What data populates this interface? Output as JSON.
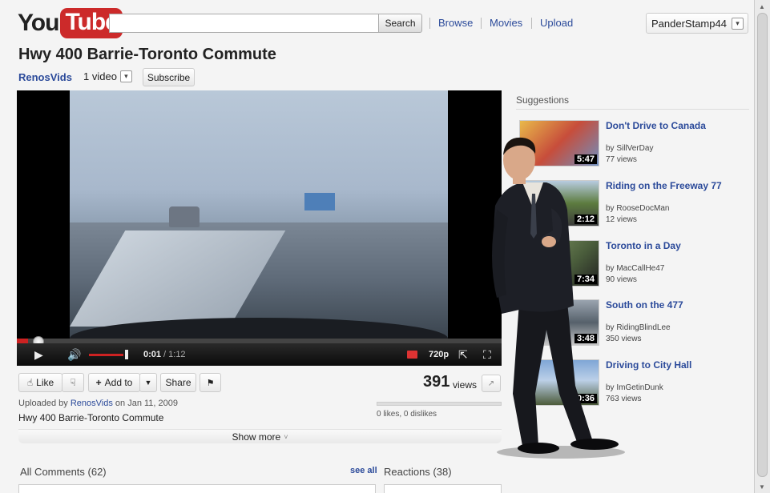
{
  "header": {
    "logo_you": "You",
    "logo_tube": "Tube",
    "search_button": "Search",
    "nav": [
      "Browse",
      "Movies",
      "Upload"
    ],
    "username": "PanderStamp44"
  },
  "video": {
    "title": "Hwy 400 Barrie-Toronto Commute",
    "channel": "RenosVids",
    "channel_videos": "1 video",
    "subscribe_label": "Subscribe",
    "current_time": "0:01",
    "duration": "/ 1:12",
    "quality": "720p",
    "progress_fraction": 0.015,
    "volume_fraction": 0.9
  },
  "actions": {
    "like_label": "Like",
    "add_to_label": "Add to",
    "share_label": "Share",
    "view_count": "391",
    "views_label": "views",
    "upload_prefix": "Uploaded by",
    "uploader": "RenosVids",
    "upload_date": "on Jan 11, 2009",
    "description": "Hwy 400 Barrie-Toronto Commute",
    "likes_text": "0 likes, 0 dislikes",
    "show_more": "Show more"
  },
  "comments": {
    "header": "All Comments (62)",
    "see_all": "see all",
    "reactions": "Reactions (38)"
  },
  "suggestions": {
    "header": "Suggestions",
    "items": [
      {
        "title": "Don't Drive to Canada",
        "by": "by SillVerDay",
        "views": "77 views",
        "duration": "5:47"
      },
      {
        "title": "Riding on the Freeway 77",
        "by": "by RooseDocMan",
        "views": "12 views",
        "duration": "2:12"
      },
      {
        "title": "Toronto in a Day",
        "by": "by MacCallHe47",
        "views": "90 views",
        "duration": "7:34"
      },
      {
        "title": "South on the 477",
        "by": "by RidingBlindLee",
        "views": "350 views",
        "duration": "3:48"
      },
      {
        "title": "Driving to City Hall",
        "by": "by  ImGetinDunk",
        "views": "763 views",
        "duration": "0:36"
      }
    ]
  },
  "colors": {
    "accent_red": "#cc2a2a",
    "link_blue": "#2b4a9a"
  }
}
